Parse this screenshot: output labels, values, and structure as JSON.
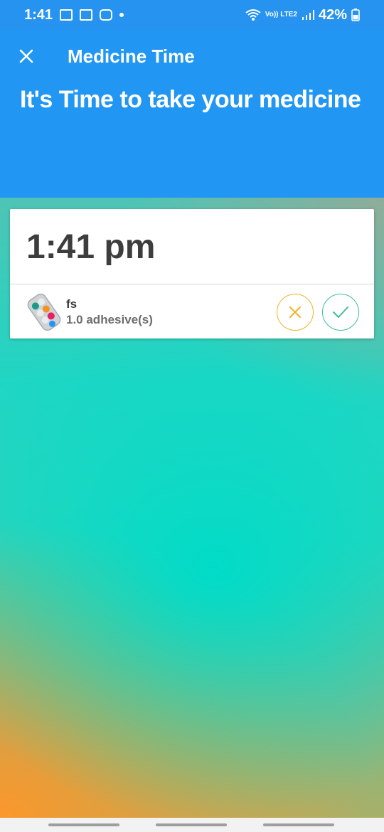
{
  "status_bar": {
    "time": "1:41",
    "network_label": "Vo)) LTE2",
    "battery": "42%"
  },
  "header": {
    "title": "Medicine Time",
    "headline": "It's Time to take your medicine"
  },
  "card": {
    "time": "1:41 pm",
    "medicine": {
      "name": "fs",
      "dose": "1.0 adhesive(s)"
    }
  },
  "colors": {
    "header_bg": "#2196f3",
    "status_bg": "#2593ef",
    "skip_accent": "#f0b429",
    "take_accent": "#3dbd9a"
  },
  "icons": {
    "close": "close-icon",
    "pill": "pill-blister-icon",
    "skip": "x-icon",
    "take": "check-icon"
  }
}
